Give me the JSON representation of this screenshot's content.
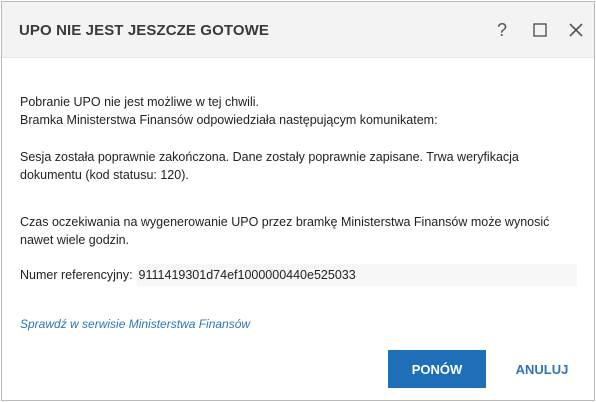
{
  "dialog": {
    "title": "UPO NIE JEST JESZCZE GOTOWE",
    "help_icon": "help-icon",
    "maximize_icon": "maximize-icon",
    "close_icon": "close-icon"
  },
  "message": {
    "line1": "Pobranie UPO nie jest możliwe w tej chwili.",
    "line2": "Bramka Ministerstwa Finansów odpowiedziała następującym komunikatem:",
    "server_message": "Sesja została poprawnie zakończona. Dane zostały poprawnie zapisane. Trwa weryfikacja dokumentu (kod statusu: 120).",
    "wait_info": "Czas oczekiwania na wygenerowanie UPO przez bramkę Ministerstwa Finansów może wynosić nawet wiele godzin."
  },
  "reference": {
    "label": "Numer referencyjny:",
    "value": "9111419301d74ef1000000440e525033"
  },
  "link": {
    "label": "Sprawdź w serwisie Ministerstwa Finansów"
  },
  "buttons": {
    "retry_label": "PONÓW",
    "cancel_label": "ANULUJ"
  },
  "colors": {
    "accent": "#1f6fb8",
    "link": "#2e75b6",
    "titlebar_bg": "#f3f3f3"
  }
}
